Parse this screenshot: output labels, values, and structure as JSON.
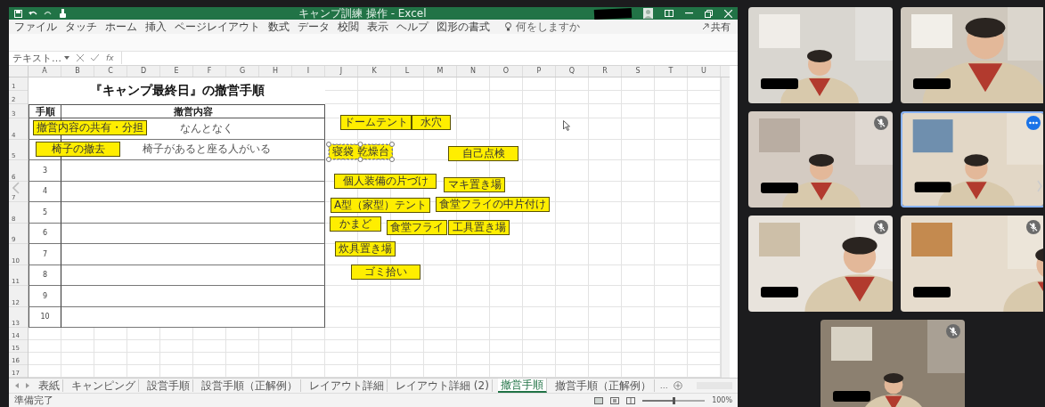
{
  "window": {
    "title": "キャンプ訓練 操作 - Excel"
  },
  "ribbon": {
    "tabs": [
      "ファイル",
      "タッチ",
      "ホーム",
      "挿入",
      "ページレイアウト",
      "数式",
      "データ",
      "校閲",
      "表示",
      "ヘルプ",
      "図形の書式"
    ],
    "search": "何をしますか",
    "share": "共有"
  },
  "formula_bar": {
    "name_box": "テキスト…",
    "function_label": "fx"
  },
  "sheet": {
    "columns": [
      "A",
      "B",
      "C",
      "D",
      "E",
      "F",
      "G",
      "H",
      "I",
      "J",
      "K",
      "L",
      "M",
      "N",
      "O",
      "P",
      "Q",
      "R",
      "S",
      "T",
      "U"
    ],
    "rows": [
      "1",
      "2",
      "3",
      "4",
      "5",
      "6",
      "7",
      "8",
      "9",
      "10",
      "11",
      "12",
      "13",
      "14",
      "15",
      "16",
      "17"
    ],
    "title": "『キャンプ最終日』の撤営手順",
    "table": {
      "headers": [
        "手順",
        "撤営内容"
      ],
      "rows": [
        {
          "note": "なんとなく"
        },
        {
          "note": "椅子があると座る人がいる"
        },
        {
          "step": "3"
        },
        {
          "step": "4"
        },
        {
          "step": "5"
        },
        {
          "step": "6"
        },
        {
          "step": "7"
        },
        {
          "step": "8"
        },
        {
          "step": "9"
        },
        {
          "step": "10"
        }
      ]
    },
    "shapes": [
      {
        "text": "撤営内容の共有・分担",
        "selected": false
      },
      {
        "text": "椅子の撤去",
        "selected": false
      },
      {
        "text": "ドームテント",
        "selected": false
      },
      {
        "text": "水穴",
        "selected": false
      },
      {
        "text": "寝袋 乾燥台",
        "selected": true
      },
      {
        "text": "自己点検",
        "selected": false
      },
      {
        "text": "個人装備の片づけ",
        "selected": false
      },
      {
        "text": "マキ置き場",
        "selected": false
      },
      {
        "text": "A型（家型）テント",
        "selected": false
      },
      {
        "text": "食堂フライの中片付け",
        "selected": false
      },
      {
        "text": "かまど",
        "selected": false
      },
      {
        "text": "食堂フライ",
        "selected": false
      },
      {
        "text": "工具置き場",
        "selected": false
      },
      {
        "text": "炊具置き場",
        "selected": false
      },
      {
        "text": "ゴミ拾い",
        "selected": false
      }
    ]
  },
  "sheet_tabs": [
    {
      "label": "表紙",
      "selected": false
    },
    {
      "label": "キャンピング",
      "selected": false
    },
    {
      "label": "設営手順",
      "selected": false
    },
    {
      "label": "設営手順（正解例）",
      "selected": false
    },
    {
      "label": "レイアウト詳細",
      "selected": false
    },
    {
      "label": "レイアウト詳細 (2)",
      "selected": false
    },
    {
      "label": "撤営手順",
      "selected": true
    },
    {
      "label": "撤営手順（正解例）",
      "selected": false
    }
  ],
  "more_tabs": "…",
  "status_bar": {
    "text": "準備完了",
    "zoom": {
      "level": 0.5,
      "reading": "100%"
    }
  },
  "video_tiles": [
    {
      "kind": "picture",
      "muted": false,
      "active": false
    },
    {
      "kind": "picture",
      "muted": false,
      "active": false
    },
    {
      "kind": "picture",
      "muted": true,
      "active": false
    },
    {
      "kind": "picture",
      "muted": false,
      "active": true
    },
    {
      "kind": "picture",
      "muted": true,
      "active": false
    },
    {
      "kind": "picture",
      "muted": true,
      "active": false
    },
    {
      "kind": "picture",
      "muted": true,
      "active": false
    }
  ]
}
